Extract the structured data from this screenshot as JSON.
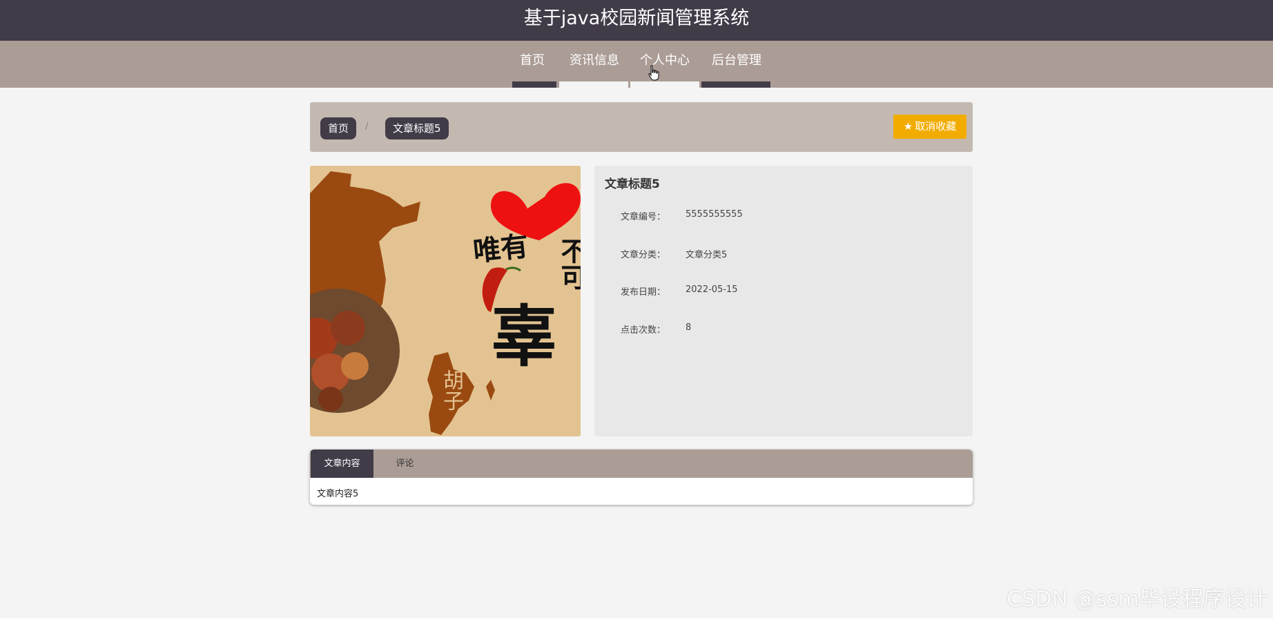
{
  "header": {
    "title": "基于java校园新闻管理系统"
  },
  "nav": {
    "items": [
      {
        "label": "首页"
      },
      {
        "label": "资讯信息"
      },
      {
        "label": "个人中心"
      },
      {
        "label": "后台管理"
      }
    ]
  },
  "breadcrumb": {
    "home": "首页",
    "separator": "/",
    "current": "文章标题5"
  },
  "favorite_button": {
    "label": "取消收藏",
    "icon": "star-icon",
    "color": "#f2ac00"
  },
  "article": {
    "title": "文章标题5",
    "image_text": {
      "line1": "唯有",
      "line2": "不可",
      "big_char": "辜",
      "lower": "胡子"
    },
    "fields": [
      {
        "label": "文章编号：",
        "value": "5555555555"
      },
      {
        "label": "文章分类：",
        "value": "文章分类5"
      },
      {
        "label": "发布日期：",
        "value": "2022-05-15"
      },
      {
        "label": "点击次数：",
        "value": "8"
      }
    ]
  },
  "tabs": [
    {
      "label": "文章内容",
      "active": true
    },
    {
      "label": "评论",
      "active": false
    }
  ],
  "tab_content": "文章内容5",
  "watermark": "CSDN @ssm毕设程序设计",
  "colors": {
    "header_bg": "#423b48",
    "nav_bg": "#ab9c96",
    "breadcrumb_bg": "#c4b9b0",
    "accent": "#f2ac00"
  }
}
